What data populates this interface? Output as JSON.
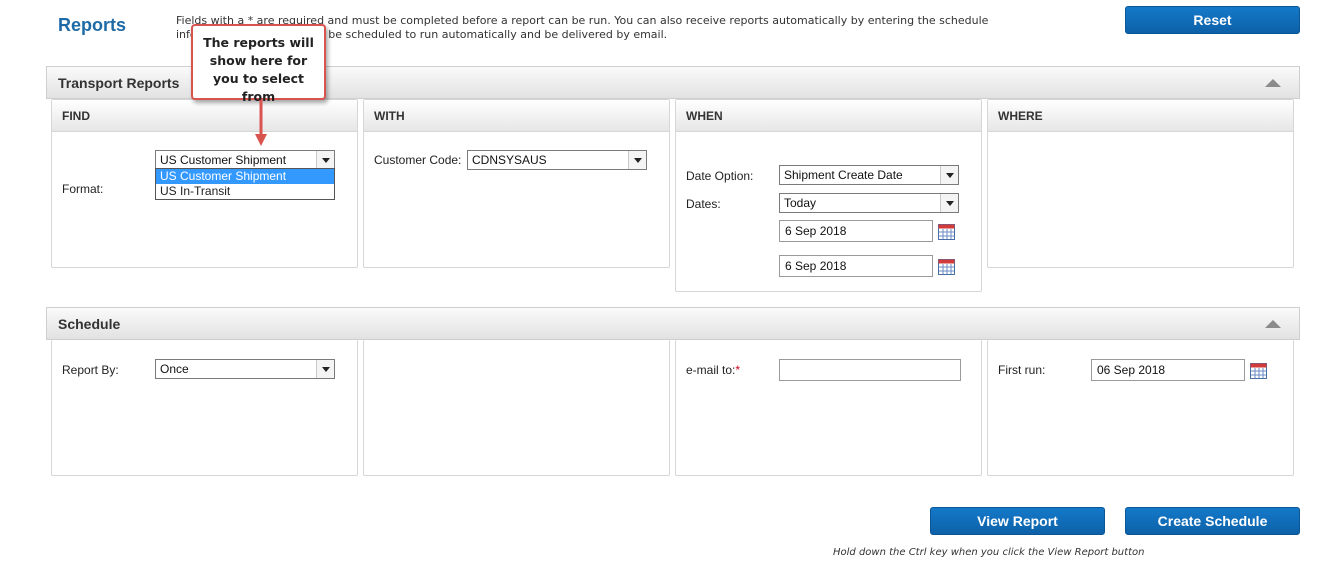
{
  "header": {
    "title": "Reports",
    "intro_line1": "Fields with a * are required and must be completed before a report can be run. You can also receive reports automatically by entering the schedule",
    "intro_line2": "information and it will then be scheduled to run automatically and be delivered by email.",
    "reset_label": "Reset"
  },
  "transport": {
    "section_title": "Transport Reports",
    "find": {
      "heading": "FIND",
      "format_label": "Format:",
      "format_value": "US Customer Shipment",
      "options": [
        "US Customer Shipment",
        "US In-Transit"
      ]
    },
    "with": {
      "heading": "WITH",
      "customer_code_label": "Customer Code:",
      "customer_code_value": "CDNSYSAUS"
    },
    "when": {
      "heading": "WHEN",
      "date_option_label": "Date Option:",
      "date_option_value": "Shipment Create Date",
      "dates_label": "Dates:",
      "dates_value": "Today",
      "date_from": "6 Sep 2018",
      "date_to": "6 Sep 2018"
    },
    "where": {
      "heading": "WHERE"
    }
  },
  "schedule": {
    "section_title": "Schedule",
    "report_by_label": "Report By:",
    "report_by_value": "Once",
    "email_label": "e-mail to:",
    "email_required_mark": "*",
    "email_value": "",
    "first_run_label": "First run:",
    "first_run_value": "06 Sep 2018"
  },
  "actions": {
    "view_report_label": "View Report",
    "create_schedule_label": "Create Schedule",
    "hint": "Hold down the Ctrl key when you click the View Report button"
  },
  "callout": {
    "text": "The reports will show here for you to select from"
  },
  "colors": {
    "brand_blue": "#0d61a8",
    "title_blue": "#1e6aa6",
    "selection_blue": "#3399ff",
    "callout_red": "#d9534f"
  }
}
